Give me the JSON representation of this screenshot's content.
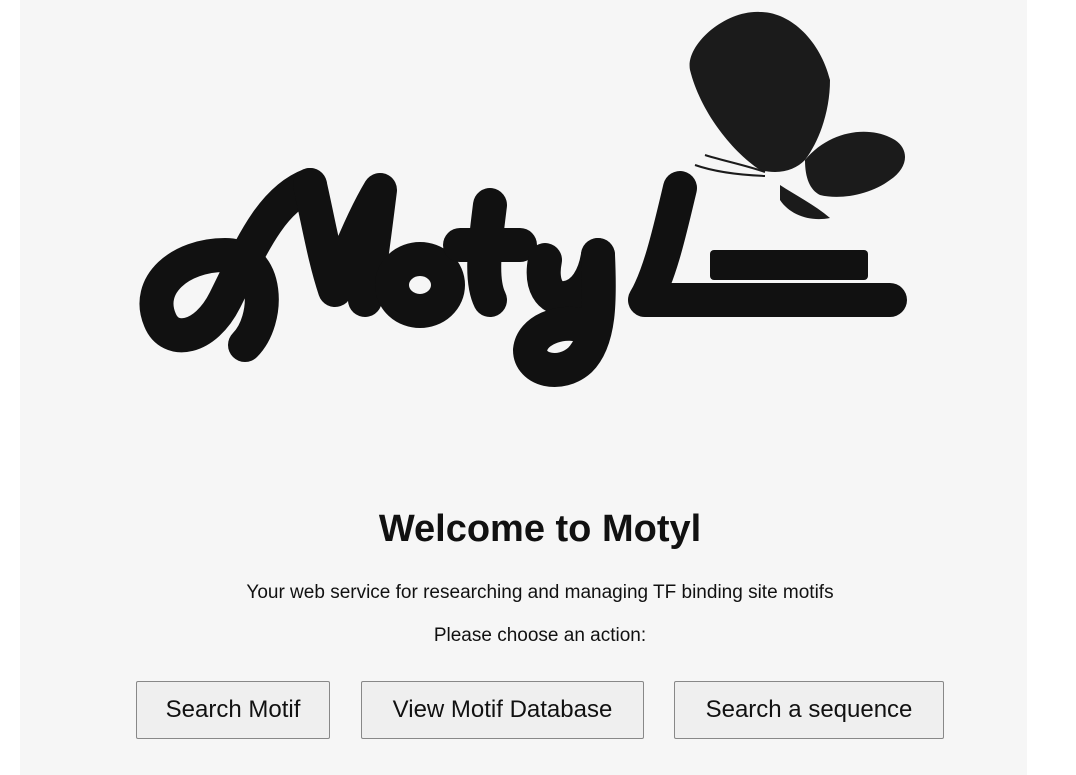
{
  "logo": {
    "text": "Motyl",
    "color": "#111111"
  },
  "welcome": {
    "title": "Welcome to Motyl",
    "subtitle": "Your web service for researching and managing TF binding site motifs",
    "prompt": "Please choose an action:"
  },
  "actions": {
    "search_motif": "Search Motif",
    "view_database": "View Motif Database",
    "search_sequence": "Search a sequence"
  },
  "colors": {
    "background": "#f6f6f6",
    "button_background": "#efefef",
    "button_border": "#888888",
    "text": "#111111"
  }
}
